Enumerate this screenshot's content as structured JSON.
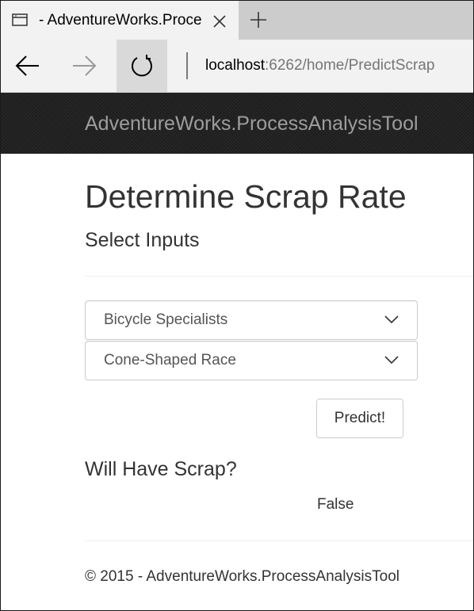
{
  "browser": {
    "tab": {
      "title": "- AdventureWorks.Proce",
      "icon": "page-icon",
      "close_icon": "close-icon"
    },
    "new_tab_icon": "plus-icon",
    "nav": {
      "back_icon": "arrow-left-icon",
      "forward_icon": "arrow-right-icon",
      "refresh_icon": "refresh-icon"
    },
    "address": {
      "host": "localhost",
      "path": ":6262/home/PredictScrap"
    }
  },
  "site": {
    "brand": "AdventureWorks.ProcessAnalysisTool",
    "header_color": "#222222",
    "brand_color": "#9d9d9d"
  },
  "main": {
    "title": "Determine Scrap Rate",
    "subtitle": "Select Inputs",
    "selects": [
      {
        "value": "Bicycle Specialists",
        "icon": "chevron-down-icon"
      },
      {
        "value": "Cone-Shaped Race",
        "icon": "chevron-down-icon"
      }
    ],
    "predict_button": "Predict!",
    "result_heading": "Will Have Scrap?",
    "result_value": "False"
  },
  "footer": {
    "text": "© 2015 - AdventureWorks.ProcessAnalysisTool"
  }
}
